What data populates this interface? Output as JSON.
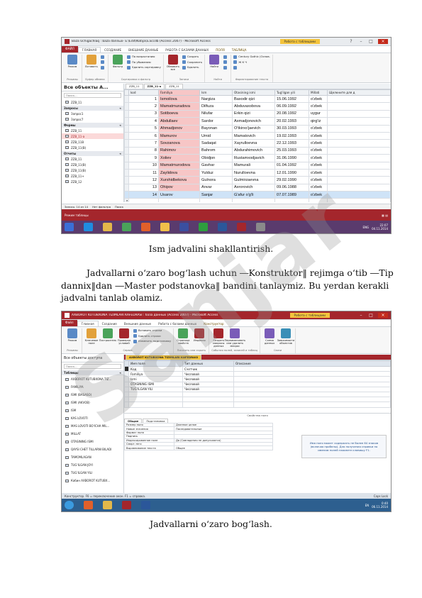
{
  "watermark": "Sanjar",
  "shot1": {
    "title": "Baza Uchigachlaq : baza dannых- E:\\Edit\\Natija\\a.accdb (Access 2007) - Microsoft Access",
    "context_tab": "Работа с таблицами",
    "tabs": [
      "ФАЙЛ",
      "ГЛАВНАЯ",
      "СОЗДАНИЕ",
      "ВНЕШНИЕ ДАННЫЕ",
      "РАБОТА С БАЗАМИ ДАННЫХ",
      "ПОЛЯ",
      "ТАБЛИЦА"
    ],
    "user": "Вход",
    "ribbon_groups": [
      {
        "label": "Режимы",
        "buttons": [
          "Режим"
        ]
      },
      {
        "label": "Буфер обмена",
        "buttons": [
          "Вставить"
        ],
        "small": [
          "",
          "",
          ""
        ]
      },
      {
        "label": "Сортировка и фильтр",
        "buttons": [
          "Фильтр"
        ],
        "small": [
          "По возрастанию",
          "По убыванию",
          "Удалить сортировку"
        ]
      },
      {
        "label": "Записи",
        "buttons": [
          "Обновить все"
        ],
        "small": [
          "Создать",
          "Сохранить",
          "Удалить"
        ]
      },
      {
        "label": "Найти",
        "buttons": [
          "Найти"
        ],
        "small": [
          "",
          "",
          ""
        ]
      },
      {
        "label": "Форматирование текста",
        "buttons": [],
        "small": [
          "Century Gothic (Основ.",
          "Ж К Ч",
          ""
        ]
      }
    ],
    "nav_title": "Все объекты A...",
    "nav_search": "Поиск...",
    "nav_groups": [
      {
        "name": "",
        "items": [
          "ZZB_11"
        ]
      },
      {
        "name": "Запросы",
        "items": [
          "Запрос1",
          "Запрос7"
        ]
      },
      {
        "name": "Формы",
        "items": [
          "ZZB_11",
          "ZZB_11-a",
          "ZZB_11B",
          "ZZB_11(B)"
        ]
      },
      {
        "name": "Отчеты",
        "items": [
          "ZZB_11",
          "ZZB_11(B)",
          "ZZB_11(B)",
          "ZZB_11+",
          "ZZB_12"
        ]
      }
    ],
    "selected_nav": "ZZB_11-a",
    "doc_tabs": [
      "ZZB_11",
      "ZZB_11-a",
      "ZZB_11"
    ],
    "columns": [
      "kod",
      "Familiya",
      "Ism",
      "Otasining ismi",
      "Tug'ilgan yili",
      "Millati",
      "Щелкните для д"
    ],
    "rows": [
      [
        "1",
        "Ismoilova",
        "Nargiza",
        "Baxodir qizi",
        "15.06.1992",
        "o'zbek"
      ],
      [
        "2",
        "Mamatmuradova",
        "Dilfuza",
        "Abduvaxobova",
        "06.09.1992",
        "o'zbek"
      ],
      [
        "3",
        "Sotiboeva",
        "Nilufar",
        "Erkin qizi",
        "20.08.1992",
        "uygur"
      ],
      [
        "4",
        "Abdullaev",
        "Sardor",
        "Axmadjonovich",
        "20.02.1993",
        "qirg'iz"
      ],
      [
        "5",
        "Ahmadjonov",
        "Bayonan",
        "O'tkirxo'jaevich",
        "30.03.1993",
        "o'zbek"
      ],
      [
        "6",
        "Mamurov",
        "Umid",
        "Mamatovich",
        "19.02.1993",
        "o'zbek"
      ],
      [
        "7",
        "Sovzanova",
        "Sadaqat",
        "Xayrulloevna",
        "22.12.1993",
        "o'zbek"
      ],
      [
        "8",
        "Rahimov",
        "Bahrom",
        "Abdurahimovich",
        "25.03.1993",
        "o'zbek"
      ],
      [
        "9",
        "Xoliev",
        "Obidjon",
        "Rustamxodjavich",
        "31.06.1990",
        "o'zbek"
      ],
      [
        "10",
        "Mamatmurodova",
        "Gavhar",
        "Mamurali",
        "01.04.1992",
        "o'zbek"
      ],
      [
        "11",
        "Zaylidova",
        "Yulduz",
        "Nurulloevna",
        "12.01.1990",
        "o'zbek"
      ],
      [
        "12",
        "Xurshidbekova",
        "Gulnora",
        "Gulmirzaevna",
        "29.02.1990",
        "o'zbek"
      ],
      [
        "13",
        "Ohipov",
        "Anvar",
        "Axrorovich",
        "09.06.1988",
        "o'zbek"
      ],
      [
        "14",
        "Usarov",
        "Sanjar",
        "G'afur o'g'li",
        "07.07.1989",
        "o'zbek"
      ]
    ],
    "record_nav": "Запись: 14 из 14",
    "filter_state": "Нет фильтра",
    "search_label": "Поиск",
    "status_left": "Режим таблицы",
    "clock_time": "22:07",
    "clock_date": "04.11.2014",
    "lang": "ENG"
  },
  "caption1": "Ism jadvalini shakllantirish.",
  "paragraph": "Jadvallarni o‘zaro bog‘lash uchun ―Konstruktor‖ rejimga o‘tib ―Tip dannix‖dan ―Master podstanovka‖ bandini tanlaymiz. Bu yerdan kerakli jadvalni tanlab olamiz.",
  "shot2": {
    "title": "AXBOROT KUTUBXONA TIZIMLARI KAFEDRASI : база данных (Access 2007) - Microsoft Access",
    "context_tab": "Работа с таблицами",
    "tabs": [
      "Файл",
      "Главная",
      "Создание",
      "Внешние данные",
      "Работа с базами данных",
      "Конструктор"
    ],
    "ribbon_groups": [
      {
        "label": "Режимы",
        "buttons": [
          "Режим"
        ]
      },
      {
        "label": "Сервис",
        "buttons": [
          "Ключевое поле",
          "Построитель",
          "Проверка условий"
        ],
        "small": [
          "Вставить строки",
          "Удалить строки",
          "Изменить подстановку"
        ]
      },
      {
        "label": "Показать или скрыть",
        "buttons": [
          "Страница свойств",
          "Индексы"
        ]
      },
      {
        "label": "События полей, записей и таблиц",
        "buttons": [
          "Создать макросы данных",
          "Переименовать или удалить макрос"
        ]
      },
      {
        "label": "Связи",
        "buttons": [
          "Схема данных",
          "Зависимости объектов"
        ]
      }
    ],
    "nav_title": "Все объекты доступа",
    "nav_search": "Поиск...",
    "nav_group": "Таблицы",
    "nav_items": [
      "AXBOROT KUTUBXONA TIZ...",
      "FAMILIYA",
      "ISMI (BASASO)",
      "ISMI (AKVOB)",
      "ISM",
      "KAS LOVOTI",
      "MAS LOVOTI BO'ICHA MIL...",
      "MILLAT",
      "OTASINING ISMI",
      "QAYSI CHET TILLARNI BILADI",
      "TAMOMLAGAN",
      "TUG'ILGAN JOYI",
      "TUG'ILGAN YILI",
      "Кабин AXBOROT KUTUBX..."
    ],
    "doc_tab": "AXBOROT KUTUBXONA TIZIMLARI KAFEDRASI",
    "columns": [
      "Имя поля",
      "Тип данных",
      "Описание"
    ],
    "rows": [
      [
        "Код",
        "Счетчик",
        ""
      ],
      [
        "Familiya",
        "Числовой",
        ""
      ],
      [
        "Ismi",
        "Числовой",
        ""
      ],
      [
        "OTASINING ISMI",
        "Числовой",
        ""
      ],
      [
        "TUG'ILGAN YILI",
        "Числовой",
        ""
      ]
    ],
    "props_caption": "Свойства поля",
    "props_tabs": [
      "Общие",
      "Подстановка"
    ],
    "props": [
      [
        "Размер поля",
        "Длинное целое"
      ],
      [
        "Новые значения",
        "Последовательные"
      ],
      [
        "Формат поля",
        ""
      ],
      [
        "Подпись",
        ""
      ],
      [
        "Индексированное поле",
        "Да (Совпадения не допускаются)"
      ],
      [
        "Смарт-теги",
        ""
      ],
      [
        "Выравнивание текста",
        "Общее"
      ]
    ],
    "hint": "Имя поля может содержать не более 64 знаков (включая пробелы). Для получения справки по именам полей нажмите клавишу F1.",
    "status_left": "Конструктор. F6 = переключение окон. F1 = справка.",
    "status_right": "Caps Lock",
    "clock_time": "0:40",
    "clock_date": "06.11.2014",
    "lang": "EN"
  },
  "caption2": "Jadvallarni o‘zaro bog‘lash.",
  "colors": {
    "access_red": "#a4262c",
    "context_yellow": "#f4c43c",
    "taskbar1": "#5a3b6d",
    "taskbar2": "#2d5f8f",
    "selection_pink": "#f7c6c6",
    "selection_blue": "#cfe3f7"
  }
}
